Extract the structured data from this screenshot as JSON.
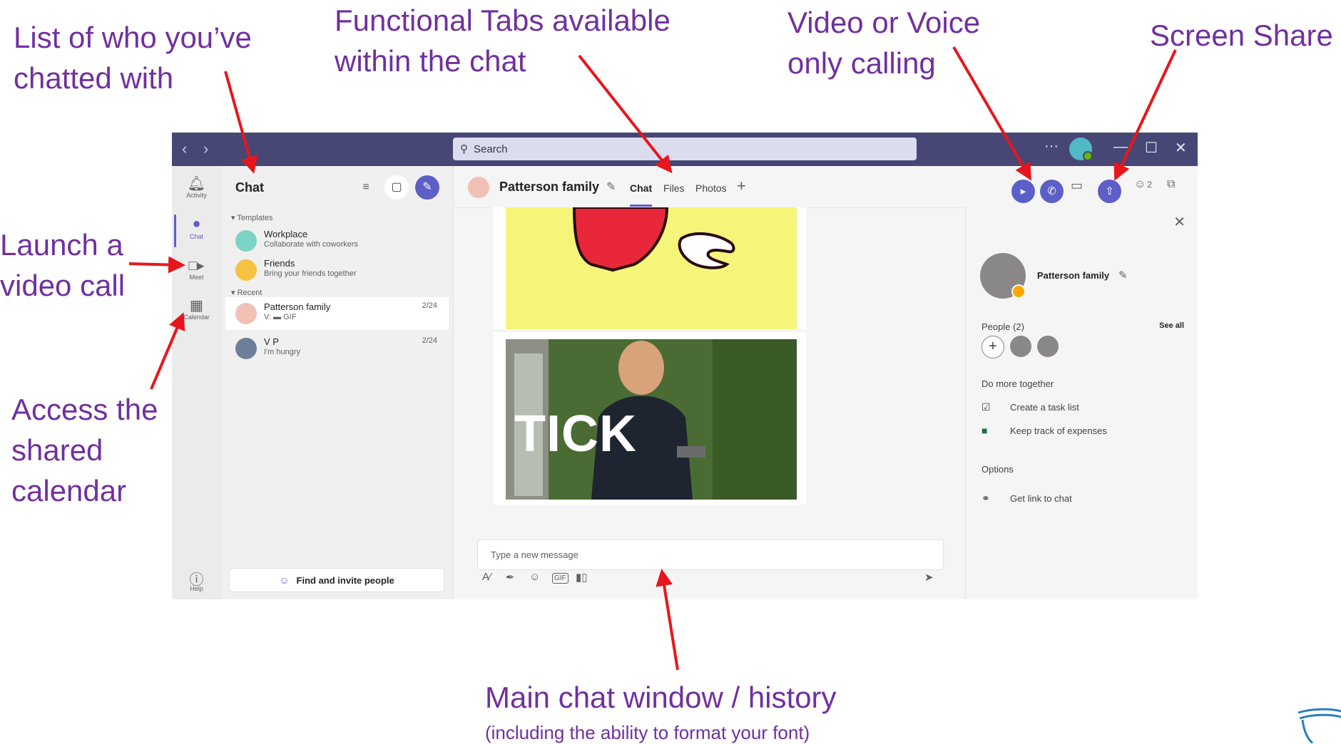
{
  "annotations": {
    "chatted_with": "List of who you’ve\nchatted with",
    "functional_tabs": "Functional Tabs available\nwithin the chat",
    "calling": "Video or Voice\nonly calling",
    "screen_share": "Screen Share",
    "video_call": "Launch a\nvideo call",
    "calendar": "Access the\nshared\ncalendar",
    "main_window": "Main chat window / history",
    "main_window_sub": "(including the ability to format your font)"
  },
  "colors": {
    "annotation": "#7030a0",
    "arrow": "#e8161c",
    "titlebar": "#464775",
    "accent": "#5b5fc7"
  },
  "titlebar": {
    "back_icon": "chevron-left-icon",
    "forward_icon": "chevron-right-icon",
    "search_placeholder": "Search",
    "more_icon": "ellipsis-icon",
    "minimize_icon": "minimize-icon",
    "maximize_icon": "maximize-icon",
    "close_icon": "close-icon"
  },
  "rail": {
    "items": [
      {
        "label": "Activity",
        "icon": "bell-icon"
      },
      {
        "label": "Chat",
        "icon": "chat-icon"
      },
      {
        "label": "Meet",
        "icon": "video-icon"
      },
      {
        "label": "Calendar",
        "icon": "calendar-icon"
      }
    ],
    "help": {
      "label": "Help",
      "icon": "help-icon"
    }
  },
  "chat_list": {
    "title": "Chat",
    "sections": {
      "templates": "Templates",
      "recent": "Recent"
    },
    "templates": [
      {
        "name": "Workplace",
        "desc": "Collaborate with coworkers"
      },
      {
        "name": "Friends",
        "desc": "Bring your friends together"
      }
    ],
    "recent": [
      {
        "name": "Patterson family",
        "preview": "V: ▬ GIF",
        "date": "2/24"
      },
      {
        "name": "V P",
        "preview": "I'm hungry",
        "date": "2/24"
      }
    ],
    "invite_label": "Find and invite people"
  },
  "chat": {
    "title": "Patterson family",
    "tabs": [
      "Chat",
      "Files",
      "Photos"
    ],
    "gif_text": "TICK",
    "composer_placeholder": "Type a new message",
    "participant_count": "2"
  },
  "details": {
    "name": "Patterson family",
    "people_label": "People (2)",
    "see_all": "See all",
    "do_more": "Do more together",
    "actions": [
      "Create a task list",
      "Keep track of expenses"
    ],
    "options_label": "Options",
    "get_link": "Get link to chat"
  }
}
